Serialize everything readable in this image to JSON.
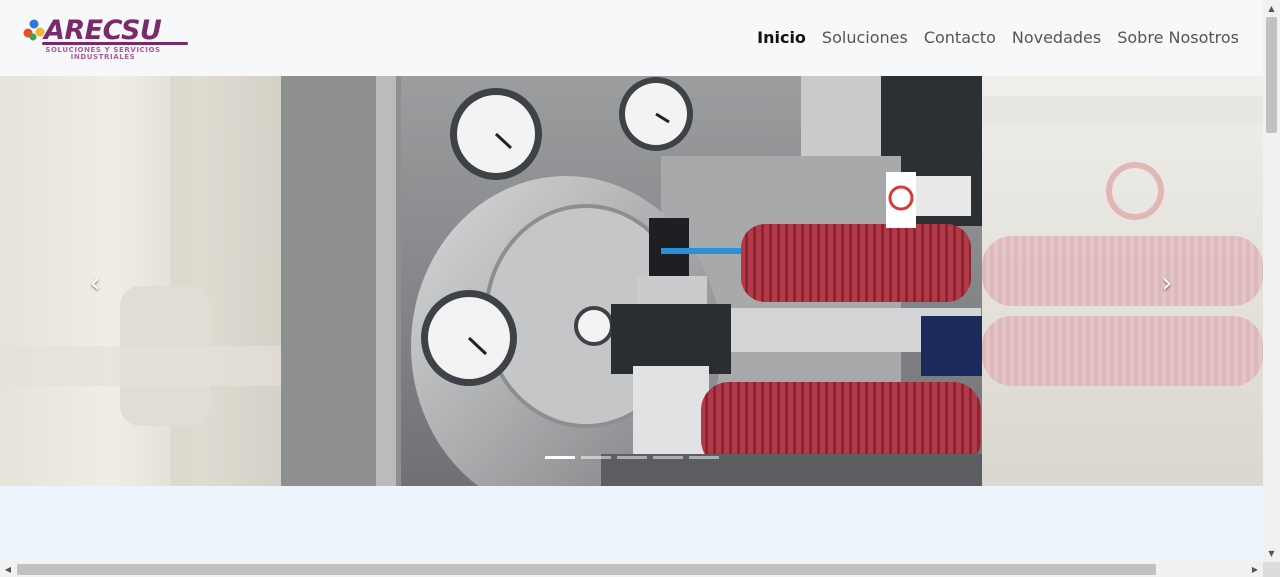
{
  "brand": {
    "name": "ARECSU",
    "subtitle_line1": "SOLUCIONES Y SERVICIOS",
    "subtitle_line2": "INDUSTRIALES",
    "color": "#7a2a6a"
  },
  "nav": {
    "items": [
      {
        "label": "Inicio",
        "active": true
      },
      {
        "label": "Soluciones",
        "active": false
      },
      {
        "label": "Contacto",
        "active": false
      },
      {
        "label": "Novedades",
        "active": false
      },
      {
        "label": "Sobre Nosotros",
        "active": false
      }
    ]
  },
  "carousel": {
    "prev_icon": "chevron-left-icon",
    "next_icon": "chevron-right-icon",
    "prev_glyph": "‹",
    "next_glyph": "›",
    "slide_count": 5,
    "active_index": 0
  },
  "scrollbars": {
    "up_glyph": "▲",
    "down_glyph": "▼",
    "left_glyph": "◀",
    "right_glyph": "▶"
  }
}
